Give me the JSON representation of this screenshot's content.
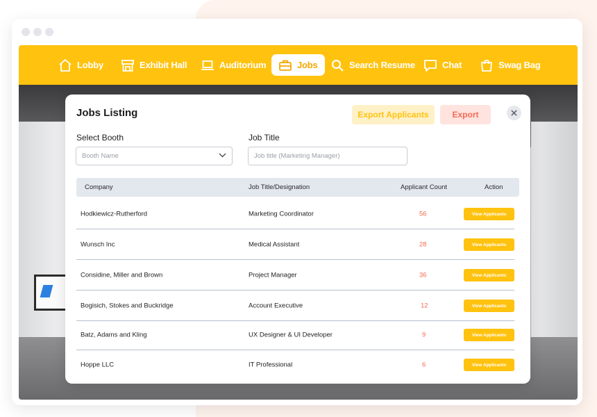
{
  "nav": {
    "items": [
      {
        "label": "Lobby",
        "icon": "home-icon"
      },
      {
        "label": "Exhibit Hall",
        "icon": "store-icon"
      },
      {
        "label": "Auditorium",
        "icon": "laptop-icon"
      },
      {
        "label": "Jobs",
        "icon": "briefcase-icon",
        "active": true
      },
      {
        "label": "Search Resume",
        "icon": "search-icon"
      },
      {
        "label": "Chat",
        "icon": "chat-icon"
      },
      {
        "label": "Swag Bag",
        "icon": "bag-icon"
      }
    ]
  },
  "modal": {
    "title": "Jobs Listing",
    "export_applicants_label": "Export Applicants",
    "export_label": "Export",
    "close_icon": "close-icon"
  },
  "filters": {
    "booth_label": "Select Booth",
    "booth_placeholder": "Booth Name",
    "job_title_label": "Job Title",
    "job_title_placeholder": "Job title (Marketing Manager)"
  },
  "table": {
    "headers": {
      "company": "Company",
      "job_title": "Job Title/Designation",
      "applicant_count": "Applicant Count",
      "action": "Action"
    },
    "rows": [
      {
        "company": "Hodkiewicz-Rutherford",
        "job_title": "Marketing Coordinator",
        "count": "56",
        "action": "View Applicants"
      },
      {
        "company": "Wunsch Inc",
        "job_title": "Medical Assistant",
        "count": "28",
        "action": "View Applicants"
      },
      {
        "company": "Considine, Miller and Brown",
        "job_title": "Project Manager",
        "count": "36",
        "action": "View Applicants"
      },
      {
        "company": "Bogisich, Stokes and Buckridge",
        "job_title": "Account Executive",
        "count": "12",
        "action": "View Applicants"
      },
      {
        "company": "Batz, Adams and Kling",
        "job_title": "UX Designer & UI Developer",
        "count": "9",
        "action": "View Applicants"
      },
      {
        "company": "Hoppe LLC",
        "job_title": "IT Professional",
        "count": "6",
        "action": "View Applicants"
      }
    ]
  },
  "colors": {
    "accent": "#ffc20e",
    "export_text": "#f36b55",
    "count_text": "#f26b4f"
  }
}
